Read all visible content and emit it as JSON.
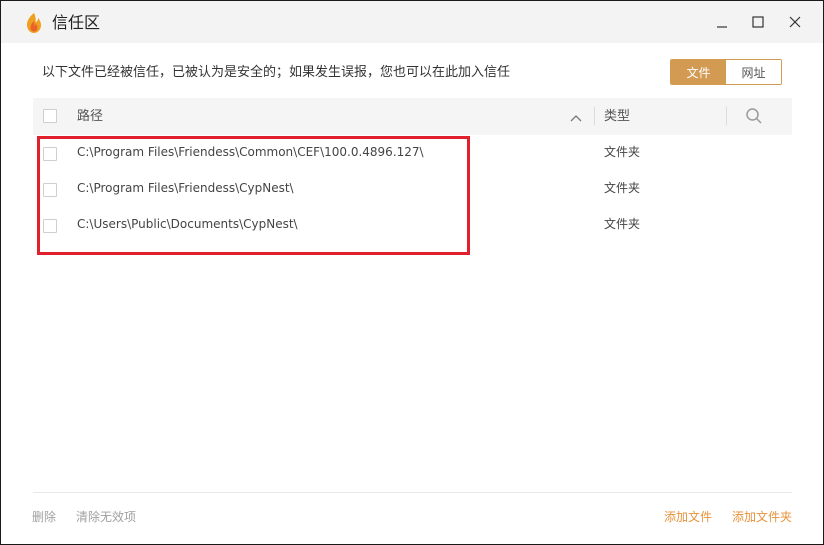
{
  "window": {
    "title": "信任区",
    "icon": "flame-shield-icon"
  },
  "description": "以下文件已经被信任，已被认为是安全的；如果发生误报，您也可以在此加入信任",
  "tabs": [
    {
      "label": "文件",
      "active": true
    },
    {
      "label": "网址",
      "active": false
    }
  ],
  "table": {
    "columns": {
      "path": "路径",
      "type": "类型"
    },
    "rows": [
      {
        "path": "C:\\Program Files\\Friendess\\Common\\CEF\\100.0.4896.127\\",
        "type": "文件夹"
      },
      {
        "path": "C:\\Program Files\\Friendess\\CypNest\\",
        "type": "文件夹"
      },
      {
        "path": "C:\\Users\\Public\\Documents\\CypNest\\",
        "type": "文件夹"
      }
    ]
  },
  "footer": {
    "delete": "删除",
    "clear_invalid": "清除无效项",
    "add_file": "添加文件",
    "add_folder": "添加文件夹"
  },
  "colors": {
    "accent": "#d29a52",
    "link": "#e8923a",
    "highlight": "#e0202c"
  }
}
